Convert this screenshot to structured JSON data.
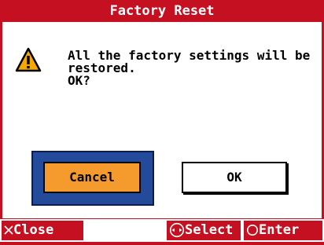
{
  "dialog": {
    "title": "Factory Reset",
    "message_lines": [
      "All the factory settings will be",
      "restored.",
      "OK?"
    ],
    "icon": "warning-icon"
  },
  "buttons": {
    "cancel_label": "Cancel",
    "ok_label": "OK",
    "focused": "cancel"
  },
  "footer": {
    "close_label": "Close",
    "close_icon": "x-icon",
    "select_label": "Select",
    "select_icon": "dial-icon",
    "enter_label": "Enter",
    "enter_icon": "circle-icon"
  },
  "colors": {
    "accent_red": "#c41020",
    "focus_blue": "#244a9c",
    "focus_orange": "#f59a2c",
    "warning_yellow": "#f6a800"
  }
}
